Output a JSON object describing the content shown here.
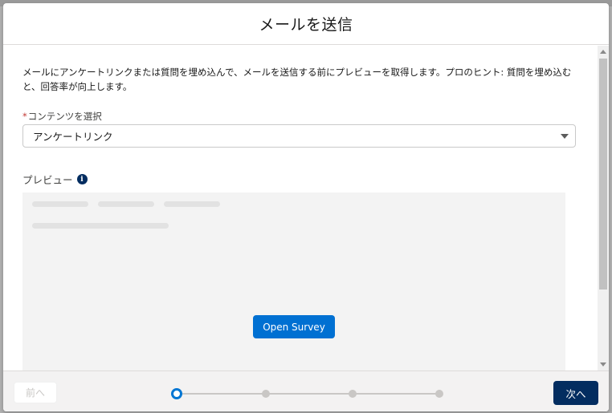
{
  "modal": {
    "title": "メールを送信",
    "description": "メールにアンケートリンクまたは質問を埋め込んで、メールを送信する前にプレビューを取得します。プロのヒント: 質問を埋め込むと、回答率が向上します。",
    "content_field": {
      "required_marker": "*",
      "label": "コンテンツを選択",
      "selected_value": "アンケートリンク"
    },
    "preview": {
      "label": "プレビュー",
      "info_icon_glyph": "i",
      "open_survey_label": "Open Survey"
    }
  },
  "footer": {
    "prev_label": "前へ",
    "next_label": "次へ",
    "progress": {
      "total_steps": 4,
      "current_step": 1
    }
  },
  "colors": {
    "brand_blue": "#0070d2",
    "dark_navy": "#032d60",
    "required_red": "#c23934"
  },
  "icons": {
    "info": "info-icon",
    "select_caret": "chevron-down-icon"
  }
}
